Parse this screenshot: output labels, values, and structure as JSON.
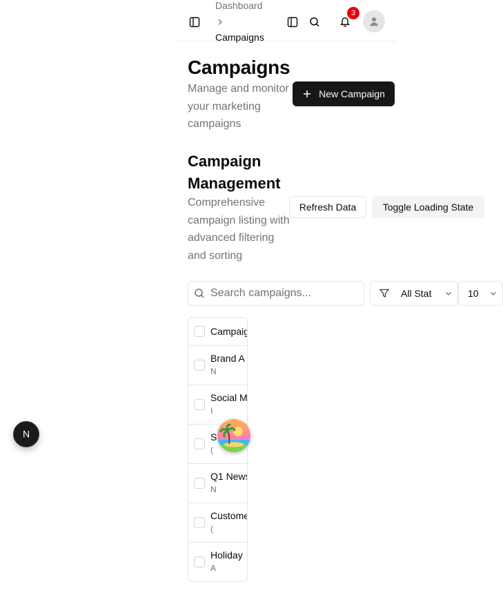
{
  "breadcrumb": {
    "parent": "Dashboard",
    "current": "Campaigns"
  },
  "header": {
    "notification_count": "3"
  },
  "page": {
    "title": "Campaigns",
    "subtitle": "Manage and monitor your marketing campaigns",
    "new_button": "New Campaign"
  },
  "section": {
    "title": "Campaign Management",
    "subtitle": "Comprehensive campaign listing with advanced filtering and sorting",
    "refresh_button": "Refresh Data",
    "toggle_button": "Toggle Loading State"
  },
  "filters": {
    "search_placeholder": "Search campaigns...",
    "status_value": "All Stat",
    "rows_value": "10"
  },
  "table": {
    "header": "Campaig",
    "rows": [
      {
        "name": "Brand A",
        "sub": "N"
      },
      {
        "name": "Social M",
        "sub": "I"
      },
      {
        "name": "S",
        "sub": "("
      },
      {
        "name": "Q1 News",
        "sub": "N"
      },
      {
        "name": "Custome",
        "sub": "("
      },
      {
        "name": "Holiday",
        "sub": "A"
      }
    ]
  },
  "floating": {
    "dev_badge_letter": "N"
  },
  "colors": {
    "primary": "#171717",
    "badge": "#e7000b",
    "muted": "#737373",
    "border": "#e5e5e5"
  },
  "icons": [
    "sidebar-toggle-icon",
    "chevron-right-icon",
    "search-icon",
    "bell-icon",
    "user-icon",
    "plus-icon",
    "filter-icon",
    "chevron-down-icon"
  ]
}
